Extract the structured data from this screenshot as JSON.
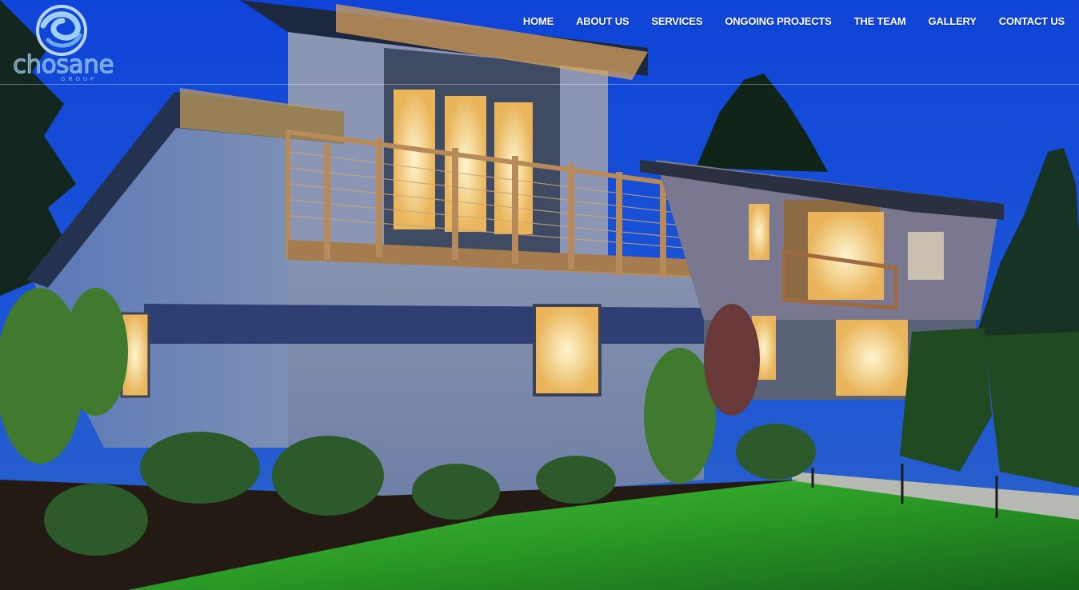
{
  "brand": {
    "logo_word": "chosane",
    "logo_sub": "GROUP"
  },
  "nav": {
    "items": [
      "HOME",
      "ABOUT US",
      "SERVICES",
      "ONGOING PROJECTS",
      "THE TEAM",
      "GALLERY",
      "CONTACT US"
    ]
  },
  "hero": {
    "image": "house-night-photo"
  },
  "colors": {
    "sky": "#1f56d8",
    "nav_text": "#ffffff",
    "lawn": "#2fa82a"
  }
}
